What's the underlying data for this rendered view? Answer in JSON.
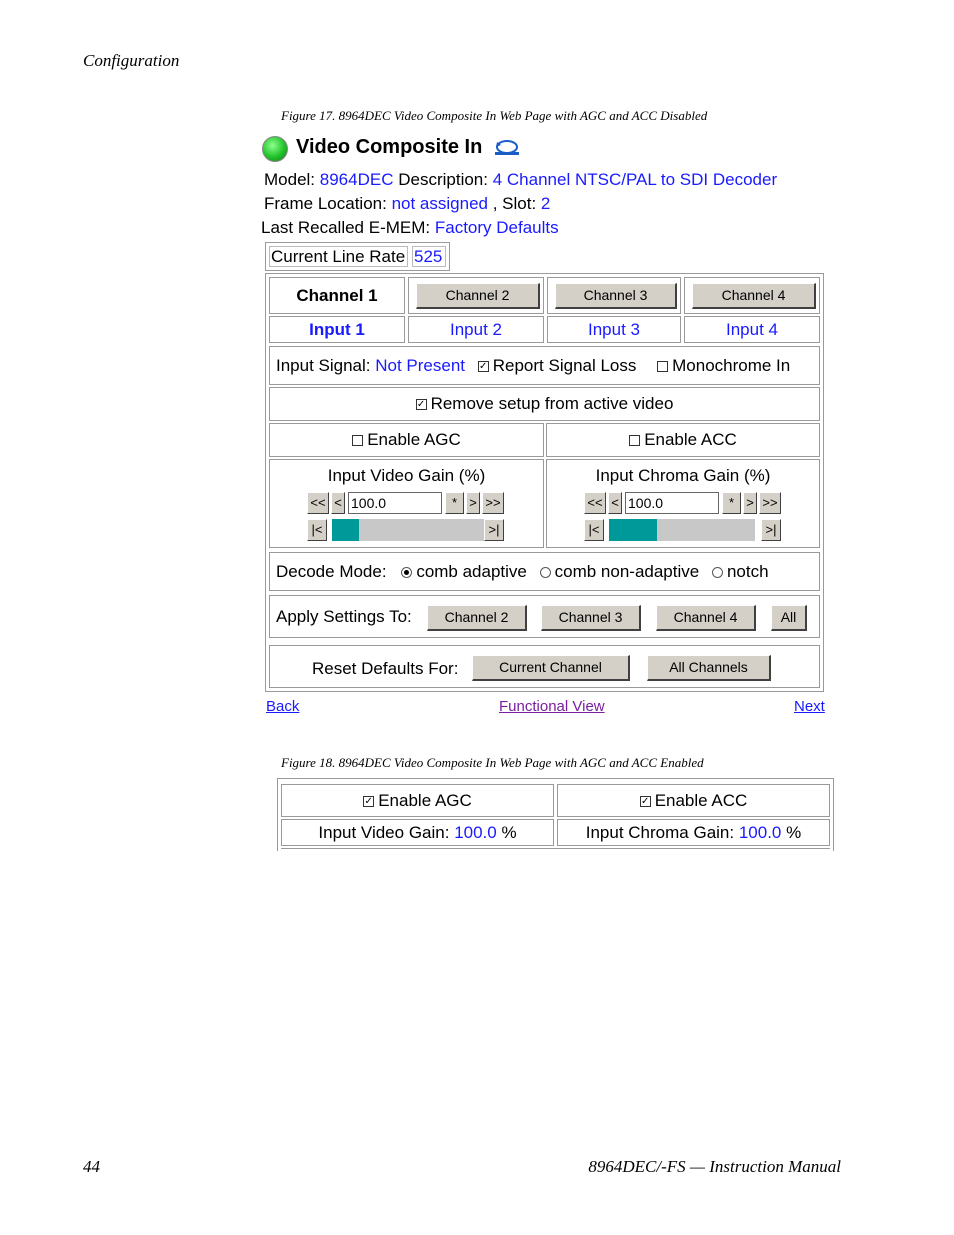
{
  "header": {
    "section": "Configuration"
  },
  "figure17": {
    "caption": "Figure 17.  8964DEC Video Composite In Web Page with AGC and ACC Disabled",
    "title": "Video Composite In",
    "status_color": "#22c22a",
    "model_label": "Model:",
    "model_value": "8964DEC",
    "description_label": "Description:",
    "description_value": "4 Channel NTSC/PAL to SDI Decoder",
    "frame_label": "Frame Location:",
    "frame_value": "not assigned",
    "slot_label": ", Slot:",
    "slot_value": "2",
    "emem_label": "Last Recalled E-MEM:",
    "emem_value": "Factory Defaults",
    "line_rate_label": "Current Line Rate",
    "line_rate_value": "525",
    "channel_tabs": [
      {
        "label": "Channel 1",
        "active": true
      },
      {
        "label": "Channel 2",
        "active": false
      },
      {
        "label": "Channel 3",
        "active": false
      },
      {
        "label": "Channel 4",
        "active": false
      }
    ],
    "inputs": [
      "Input 1",
      "Input 2",
      "Input 3",
      "Input 4"
    ],
    "input_signal_label": "Input Signal:",
    "input_signal_value": "Not Present",
    "report_signal_loss": "Report Signal Loss",
    "monochrome_in": "Monochrome In",
    "remove_setup": "Remove setup from active video",
    "enable_agc": "Enable AGC",
    "enable_acc": "Enable ACC",
    "video_gain": {
      "title": "Input Video Gain (%)",
      "value": "100.0",
      "level": 0.17
    },
    "chroma_gain": {
      "title": "Input Chroma Gain (%)",
      "value": "100.0",
      "level": 0.33
    },
    "stepper": {
      "dec_fast": "<<",
      "dec": "<",
      "star": "*",
      "inc": ">",
      "inc_fast": ">>",
      "min": "|<",
      "max": ">|"
    },
    "decode_mode_label": "Decode Mode:",
    "decode_modes": [
      {
        "label": "comb adaptive",
        "selected": true
      },
      {
        "label": "comb non-adaptive",
        "selected": false
      },
      {
        "label": "notch",
        "selected": false
      }
    ],
    "apply_label": "Apply Settings To:",
    "apply_buttons": [
      "Channel 2",
      "Channel 3",
      "Channel 4",
      "All"
    ],
    "reset_label": "Reset Defaults For:",
    "reset_buttons": [
      "Current Channel",
      "All Channels"
    ],
    "nav": {
      "back": "Back",
      "functional": "Functional View",
      "next": "Next"
    },
    "slider_fill_color": "#009999"
  },
  "figure18": {
    "caption": "Figure 18.  8964DEC Video Composite In Web Page with AGC and ACC Enabled",
    "enable_agc": "Enable AGC",
    "enable_acc": "Enable ACC",
    "video_gain_label": "Input Video Gain:",
    "video_gain_value": "100.0",
    "video_unit": "%",
    "chroma_gain_label": "Input Chroma Gain:",
    "chroma_gain_value": "100.0",
    "chroma_unit": "%"
  },
  "footer": {
    "page": "44",
    "manual": "8964DEC/-FS — Instruction Manual"
  }
}
